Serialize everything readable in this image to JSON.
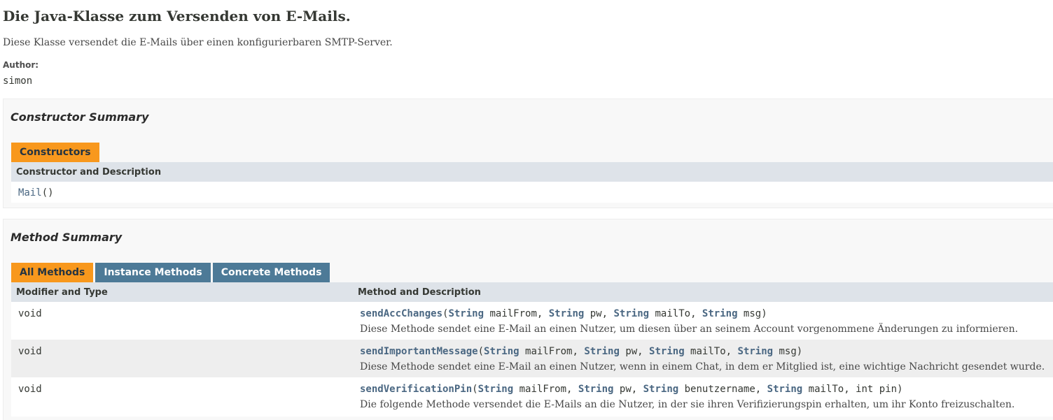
{
  "class_title": "Die Java-Klasse zum Versenden von E-Mails.",
  "class_description": "Diese Klasse versendet die E-Mails über einen konfigurierbaren SMTP-Server.",
  "author": {
    "label": "Author:",
    "value": "simon"
  },
  "constructor_summary": {
    "heading": "Constructor Summary",
    "tab": "Constructors",
    "column_header": "Constructor and Description",
    "rows": [
      {
        "name": "Mail",
        "params": "()"
      }
    ]
  },
  "method_summary": {
    "heading": "Method Summary",
    "tabs": [
      "All Methods",
      "Instance Methods",
      "Concrete Methods"
    ],
    "active_tab": "All Methods",
    "column_headers": [
      "Modifier and Type",
      "Method and Description"
    ],
    "rows": [
      {
        "modifier": "void",
        "name": "sendAccChanges",
        "sig_open": "(",
        "params": [
          {
            "type": "String",
            "name": " mailFrom, "
          },
          {
            "type": "String",
            "name": " pw, "
          },
          {
            "type": "String",
            "name": " mailTo, "
          },
          {
            "type": "String",
            "name": " msg)"
          }
        ],
        "description": "Diese Methode sendet eine E-Mail an einen Nutzer, um diesen über an seinem Account vorgenommene Änderungen zu informieren."
      },
      {
        "modifier": "void",
        "name": "sendImportantMessage",
        "sig_open": "(",
        "params": [
          {
            "type": "String",
            "name": " mailFrom, "
          },
          {
            "type": "String",
            "name": " pw, "
          },
          {
            "type": "String",
            "name": " mailTo, "
          },
          {
            "type": "String",
            "name": " msg)"
          }
        ],
        "description": "Diese Methode sendet eine E-Mail an einen Nutzer, wenn in einem Chat, in dem er Mitglied ist, eine wichtige Nachricht gesendet wurde."
      },
      {
        "modifier": "void",
        "name": "sendVerificationPin",
        "sig_open": "(",
        "params": [
          {
            "type": "String",
            "name": " mailFrom, "
          },
          {
            "type": "String",
            "name": " pw, "
          },
          {
            "type": "String",
            "name": " benutzername, "
          },
          {
            "type": "String",
            "name": " mailTo, int pin)"
          }
        ],
        "description": "Die folgende Methode versendet die E-Mails an die Nutzer, in der sie ihren Verifizierungspin erhalten, um ihr Konto freizuschalten."
      }
    ]
  },
  "colors": {
    "active_tab": "#F8981D",
    "inactive_tab": "#4D7A97",
    "link": "#4A6782",
    "header_row": "#dee3e9"
  }
}
